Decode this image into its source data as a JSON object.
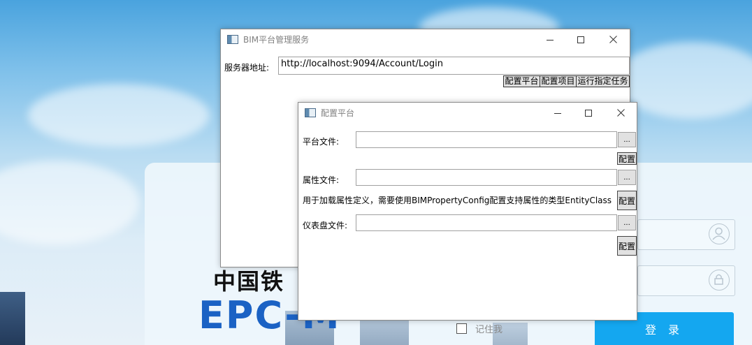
{
  "login_page": {
    "brand_cn": "中国铁",
    "brand_en": "EPC-M",
    "remember_label": "记住我",
    "login_button": "登 录",
    "user_icon": "user-icon",
    "lock_icon": "lock-icon"
  },
  "main_window": {
    "title": "BIM平台管理服务",
    "server_label": "服务器地址:",
    "server_url": "http://localhost:9094/Account/Login",
    "buttons": {
      "config_platform": "配置平台",
      "config_project": "配置项目",
      "run_task": "运行指定任务"
    }
  },
  "dialog": {
    "title": "配置平台",
    "platform_file_label": "平台文件:",
    "platform_file_value": "",
    "property_file_label": "属性文件:",
    "property_file_value": "",
    "property_hint": "用于加载属性定义，需要使用BIMPropertyConfig配置支持属性的类型EntityClass",
    "dashboard_file_label": "仪表盘文件:",
    "dashboard_file_value": "",
    "browse_label": "...",
    "config_label": "配置"
  }
}
